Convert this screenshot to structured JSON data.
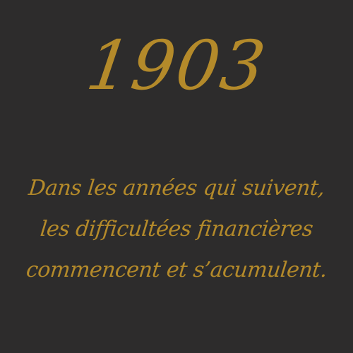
{
  "year": "1903",
  "caption": {
    "lines": [
      "Dans les années qui suivent,",
      "les difficultées financières",
      "commencent et s’acumulent."
    ]
  },
  "colors": {
    "background": "#2d2c2c",
    "text": "#b48a2a"
  }
}
